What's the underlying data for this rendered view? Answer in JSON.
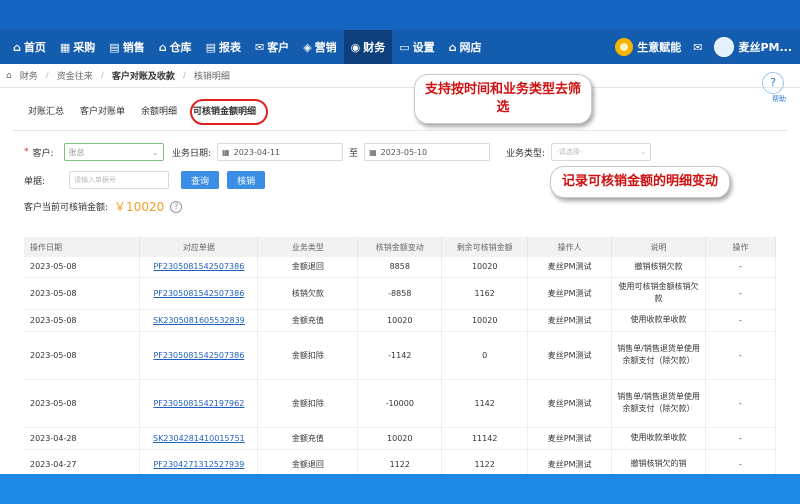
{
  "nav": {
    "items": [
      {
        "icon": "home-icon",
        "glyph": "⌂",
        "label": "首页"
      },
      {
        "icon": "purchase-icon",
        "glyph": "▦",
        "label": "采购"
      },
      {
        "icon": "sales-icon",
        "glyph": "▤",
        "label": "销售"
      },
      {
        "icon": "warehouse-icon",
        "glyph": "⌂",
        "label": "仓库"
      },
      {
        "icon": "report-icon",
        "glyph": "▤",
        "label": "报表"
      },
      {
        "icon": "customer-icon",
        "glyph": "✉",
        "label": "客户"
      },
      {
        "icon": "marketing-icon",
        "glyph": "◈",
        "label": "营销"
      },
      {
        "icon": "finance-icon",
        "glyph": "◉",
        "label": "财务",
        "active": true
      },
      {
        "icon": "settings-icon",
        "glyph": "▭",
        "label": "设置"
      },
      {
        "icon": "webstore-icon",
        "glyph": "⌂",
        "label": "网店"
      }
    ],
    "right_business": "生意赋能",
    "right_user": "麦丝PM..."
  },
  "breadcrumb": [
    "财务",
    "资金往来",
    "客户对账及收款",
    "核销明细"
  ],
  "help_label": "帮助",
  "tabs": [
    "对账汇总",
    "客户对账单",
    "余额明细",
    "可核销金额明细"
  ],
  "filters": {
    "customer_label": "客户:",
    "customer_value": "张总",
    "date_label": "业务日期:",
    "date_from": "2023-04-11",
    "date_sep": "至",
    "date_to": "2023-05-10",
    "type_label": "业务类型:",
    "type_placeholder": "-请选择-",
    "doc_label": "单据:",
    "doc_placeholder": "请输入单据号",
    "query_button": "查询",
    "writeoff_button": "核销",
    "balance_label": "客户当前可核销金额:",
    "balance_value": "￥10020",
    "balance_help": "?"
  },
  "table": {
    "headers": [
      "操作日期",
      "对应单据",
      "业务类型",
      "核销金额变动",
      "剩余可核销金额",
      "操作人",
      "说明",
      "操作"
    ],
    "rows": [
      {
        "date": "2023-05-08",
        "doc": "PF2305081542507386",
        "type": "金额退回",
        "change": "8858",
        "remain": "10020",
        "op": "麦丝PM测试",
        "desc": "撤销核销欠款",
        "action": "-"
      },
      {
        "date": "2023-05-08",
        "doc": "PF2305081542507386",
        "type": "核销欠款",
        "change": "-8858",
        "remain": "1162",
        "op": "麦丝PM测试",
        "desc": "使用可核销金额核销欠款",
        "action": "-"
      },
      {
        "date": "2023-05-08",
        "doc": "SK2305081605532839",
        "type": "金额充值",
        "change": "10020",
        "remain": "10020",
        "op": "麦丝PM测试",
        "desc": "使用收款单收款",
        "action": "-"
      },
      {
        "date": "2023-05-08",
        "doc": "PF2305081542507386",
        "type": "金额扣除",
        "change": "-1142",
        "remain": "0",
        "op": "麦丝PM测试",
        "desc": "销售单/销售退货单使用余额支付（除欠款）",
        "action": "-"
      },
      {
        "date": "2023-05-08",
        "doc": "PF2305081542197962",
        "type": "金额扣除",
        "change": "-10000",
        "remain": "1142",
        "op": "麦丝PM测试",
        "desc": "销售单/销售退货单使用余额支付（除欠款）",
        "action": "-"
      },
      {
        "date": "2023-04-28",
        "doc": "SK2304281410015751",
        "type": "金额充值",
        "change": "10020",
        "remain": "11142",
        "op": "麦丝PM测试",
        "desc": "使用收款单收款",
        "action": "-"
      },
      {
        "date": "2023-04-27",
        "doc": "PF2304271312527939",
        "type": "金额退回",
        "change": "1122",
        "remain": "1122",
        "op": "麦丝PM测试",
        "desc": "撤销核销欠的销",
        "action": "-"
      }
    ]
  },
  "annotations": {
    "filter_note": "支持按时间和业务类型去筛选",
    "amount_note": "记录可核销金额的明细变动"
  },
  "colors": {
    "nav": "#1565c0",
    "accent": "#3a8ee6",
    "highlight": "#e02020",
    "amount": "#f0a020"
  }
}
